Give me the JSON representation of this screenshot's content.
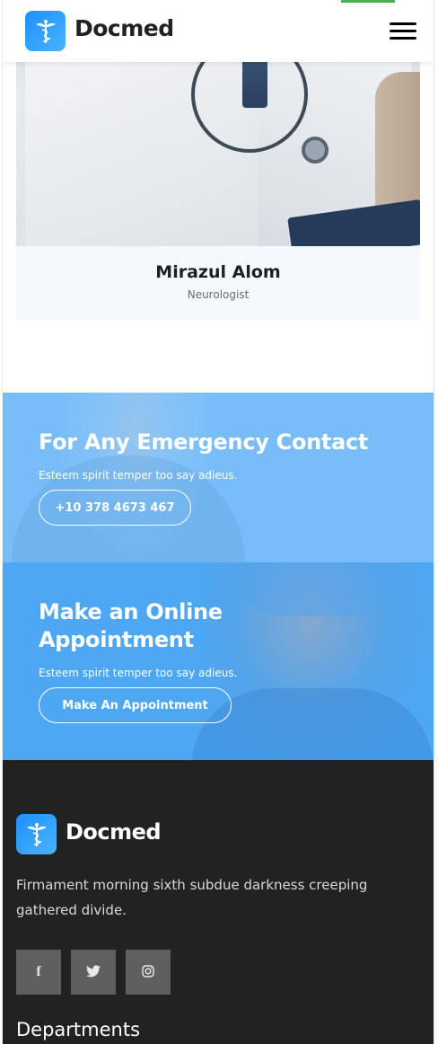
{
  "header": {
    "brand": "Docmed",
    "logo_icon": "caduceus-icon",
    "menu_icon": "hamburger-menu-icon"
  },
  "doctor_card": {
    "name": "Mirazul Alom",
    "role": "Neurologist"
  },
  "emergency": {
    "title": "For Any Emergency Contact",
    "subtitle": "Esteem spirit temper too say adieus.",
    "phone_button": "+10 378 4673 467"
  },
  "appointment": {
    "title_line1": "Make an Online",
    "title_line2": "Appointment",
    "subtitle": "Esteem spirit temper too say adieus.",
    "button": "Make An Appointment"
  },
  "footer": {
    "brand": "Docmed",
    "description": "Firmament morning sixth subdue darkness creeping gathered divide.",
    "social": [
      {
        "icon": "facebook-icon",
        "glyph": "f"
      },
      {
        "icon": "twitter-icon",
        "glyph": "🐦"
      },
      {
        "icon": "instagram-icon",
        "glyph": "◎"
      }
    ],
    "departments_heading": "Departments"
  },
  "colors": {
    "accent": "#1e90ff",
    "emergency_bg": "#79bdf8",
    "appointment_bg": "#4ea7f2",
    "footer_bg": "#222222"
  }
}
